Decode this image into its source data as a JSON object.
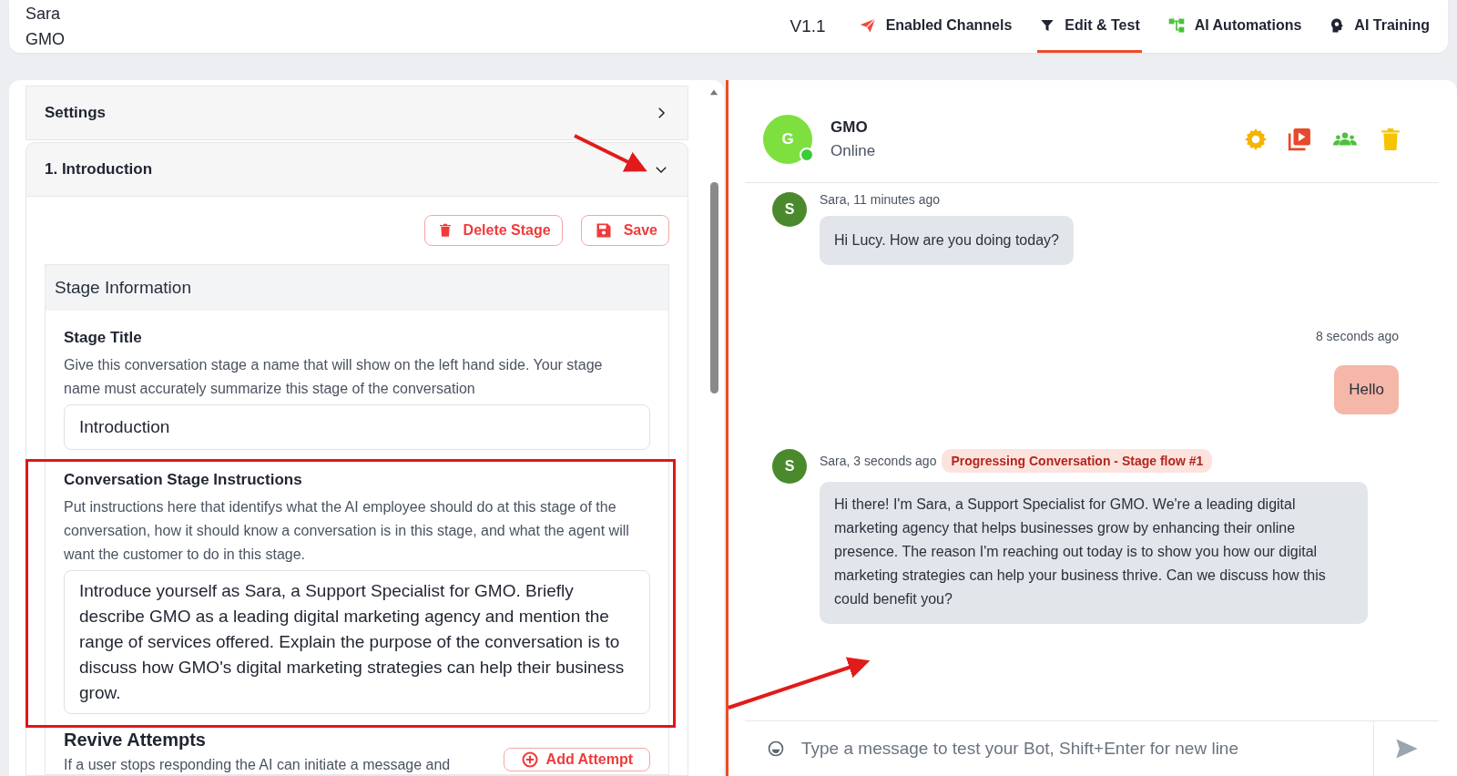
{
  "header": {
    "user_name": "Sara",
    "company": "GMO",
    "version": "V1.1",
    "nav": [
      {
        "kind": "channels",
        "label": "Enabled Channels",
        "selected": false
      },
      {
        "kind": "filter",
        "label": "Edit & Test",
        "selected": true
      },
      {
        "kind": "automations",
        "label": "AI Automations",
        "selected": false
      },
      {
        "kind": "training",
        "label": "AI Training",
        "selected": false
      }
    ]
  },
  "stages": [
    {
      "title": "Settings",
      "expanded": false
    },
    {
      "title": "1. Introduction",
      "expanded": true
    }
  ],
  "stage_actions": [
    {
      "kind": "delete",
      "label": "Delete Stage"
    },
    {
      "kind": "save",
      "label": "Save"
    }
  ],
  "stage_info": {
    "heading": "Stage Information",
    "fields": [
      {
        "label": "Stage Title",
        "description": "Give this conversation stage a name that will show on the left hand side. Your stage name must accurately summarize this stage of the conversation",
        "value": "Introduction",
        "kind": "line",
        "highlighted": false
      },
      {
        "label": "Conversation Stage Instructions",
        "description": "Put instructions here that identifys what the AI employee should do at this stage of the conversation, how it should know a conversation is in this stage, and what the agent will want the customer to do in this stage.",
        "value": "Introduce yourself as Sara, a Support Specialist for GMO. Briefly describe GMO as a leading digital marketing agency and mention the range of services offered. Explain the purpose of the conversation is to discuss how GMO's digital marketing strategies can help their business grow.",
        "kind": "area",
        "highlighted": true
      }
    ]
  },
  "revive": {
    "heading": "Revive Attempts",
    "description": "If a user stops responding the AI can initiate a message and",
    "button": "Add Attempt"
  },
  "chat": {
    "bot_initial": "G",
    "bot_name": "GMO",
    "status": "Online",
    "online": true,
    "messages": [
      {
        "kind": "received",
        "avatar": "S",
        "meta": "Sara, 11 minutes ago",
        "text": "Hi Lucy. How are you doing today?"
      },
      {
        "kind": "sent",
        "meta": "8 seconds ago",
        "text": "Hello"
      },
      {
        "kind": "received",
        "avatar": "S",
        "meta": "Sara, 3 seconds ago",
        "tag": "Progressing Conversation - Stage flow #1",
        "text": "Hi there! I'm Sara, a Support Specialist for GMO. We're a leading digital marketing agency that helps businesses grow by enhancing their online presence. The reason I'm reaching out today is to show you how our digital marketing strategies can help your business thrive. Can we discuss how this could benefit you?"
      }
    ],
    "composer": {
      "placeholder": "Type a message to test your Bot, Shift+Enter for new line"
    }
  }
}
